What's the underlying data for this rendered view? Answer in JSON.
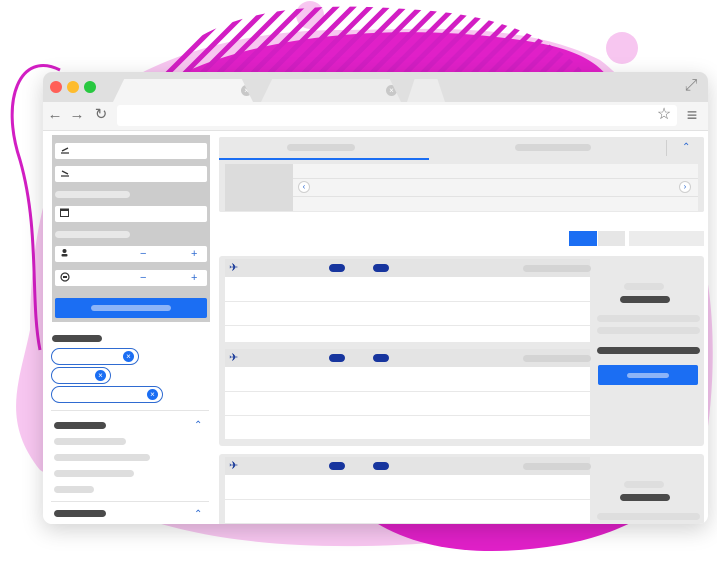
{
  "window": {
    "traffic_lights": {
      "close": "#ff5f57",
      "minimize": "#febc2e",
      "maximize": "#28c840"
    },
    "tabs": [
      {
        "close_icon": "×"
      },
      {
        "close_icon": "×"
      }
    ],
    "expand_icon": "⤢"
  },
  "toolbar": {
    "back_icon": "←",
    "forward_icon": "→",
    "reload_icon": "↻",
    "address_value": "",
    "bookmark_icon": "☆",
    "menu_icon": "≡"
  },
  "search_form": {
    "departure_icon": "plane-departure-icon",
    "arrival_icon": "plane-arrival-icon",
    "calendar_icon": "calendar-icon",
    "passengers": {
      "icon": "person-icon",
      "minus": "−",
      "plus": "+"
    },
    "cabin": {
      "icon": "cabin-class-icon",
      "minus": "−",
      "plus": "+"
    }
  },
  "filters": {
    "chip_close_icon": "×",
    "chips_count_visible": 3,
    "collapse_icon": "⌃"
  },
  "date_carousel": {
    "prev_icon": "‹",
    "next_icon": "›",
    "collapse_icon": "⌃"
  },
  "results": {
    "plane_icon": "✈"
  },
  "colors": {
    "accent": "#1b6ef3",
    "dark_pill": "#17359e",
    "panel_grey": "#cccccc",
    "card_grey": "#e9e9e9",
    "magenta_bg": "#e020c8",
    "pink_bg": "#f7c6f0"
  }
}
